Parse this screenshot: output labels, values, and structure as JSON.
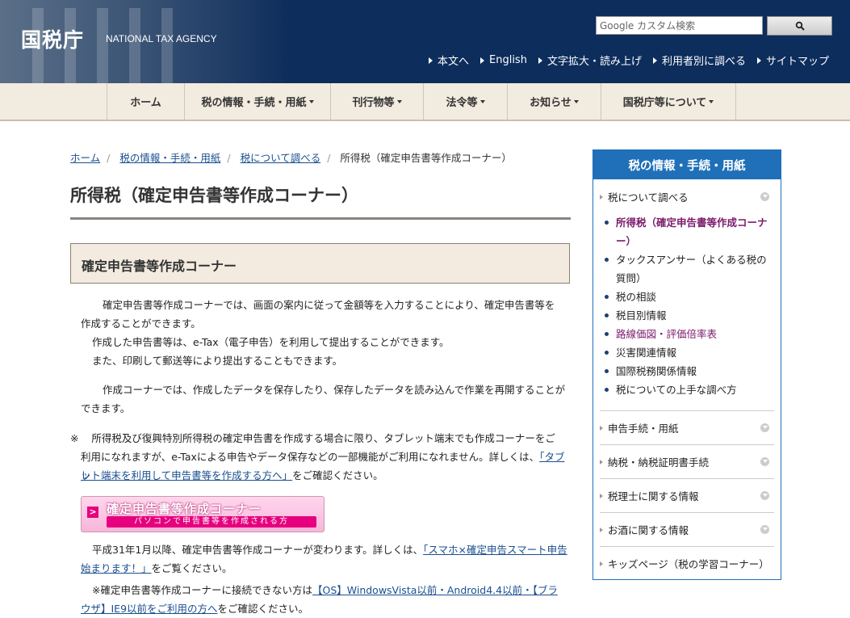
{
  "header": {
    "logo_ja": "国税庁",
    "logo_en": "NATIONAL TAX AGENCY",
    "search_placeholder": "Google カスタム検索",
    "util_links": [
      "本文へ",
      "English",
      "文字拡大・読み上げ",
      "利用者別に調べる",
      "サイトマップ"
    ]
  },
  "gnav": [
    "ホーム",
    "税の情報・手続・用紙",
    "刊行物等",
    "法令等",
    "お知らせ",
    "国税庁等について"
  ],
  "breadcrumb": [
    "ホーム",
    "税の情報・手続・用紙",
    "税について調べる",
    "所得税（確定申告書等作成コーナー）"
  ],
  "main": {
    "title": "所得税（確定申告書等作成コーナー）",
    "section_title": "確定申告書等作成コーナー",
    "p1_l1": "確定申告書等作成コーナーでは、画面の案内に従って金額等を入力することにより、確定申告書等を",
    "p1_l2": "作成することができます。",
    "p1_l3": "作成した申告書等は、e-Tax（電子申告）を利用して提出することができます。",
    "p1_l4": "また、印刷して郵送等により提出することもできます。",
    "p2_l1": "作成コーナーでは、作成したデータを保存したり、保存したデータを読み込んで作業を再開することが",
    "p2_l2": "できます。",
    "note_mark": "※",
    "note_l1": "所得税及び復興特別所得税の確定申告書を作成する場合に限り、タブレット端末でも作成コーナーをご",
    "note_l2a": "利用になれますが、e-Taxによる申告やデータ保存などの一部機能がご利用になれません。詳しくは、",
    "note_link_a": "「タブレ",
    "note_link_b": "ット端末を利用して申告書等を作成する方へ」",
    "note_l3b": "をご確認ください。",
    "banner_title": "確定申告書等作成コーナー",
    "banner_sub": "パソコンで申告書等を作成される方",
    "p3_l1a": "平成31年1月以降、確定申告書等作成コーナーが変わります。詳しくは、",
    "p3_link_a": "「スマホ×確定申告スマート申告",
    "p3_link_b": "始まります！」",
    "p3_l2b": "をご覧ください。",
    "p4_l1a": "※確定申告書等作成コーナーに接続できない方は",
    "p4_link_a": "【OS】WindowsVista以前・Android4.4以前・【ブラ",
    "p4_link_b": "ウザ】IE9以前をご利用の方へ",
    "p4_l2b": "をご確認ください。"
  },
  "sidebar": {
    "heading": "税の情報・手続・用紙",
    "cat1": "税について調べる",
    "sub": [
      "所得税（確定申告書等作成コーナー）",
      "タックスアンサー（よくある税の質問）",
      "税の相談",
      "税目別情報",
      "路線価図・評価倍率表",
      "災害関連情報",
      "国際税務関係情報",
      "税についての上手な調べ方"
    ],
    "cats": [
      "申告手続・用紙",
      "納税・納税証明書手続",
      "税理士に関する情報",
      "お酒に関する情報",
      "キッズページ（税の学習コーナー）"
    ]
  }
}
